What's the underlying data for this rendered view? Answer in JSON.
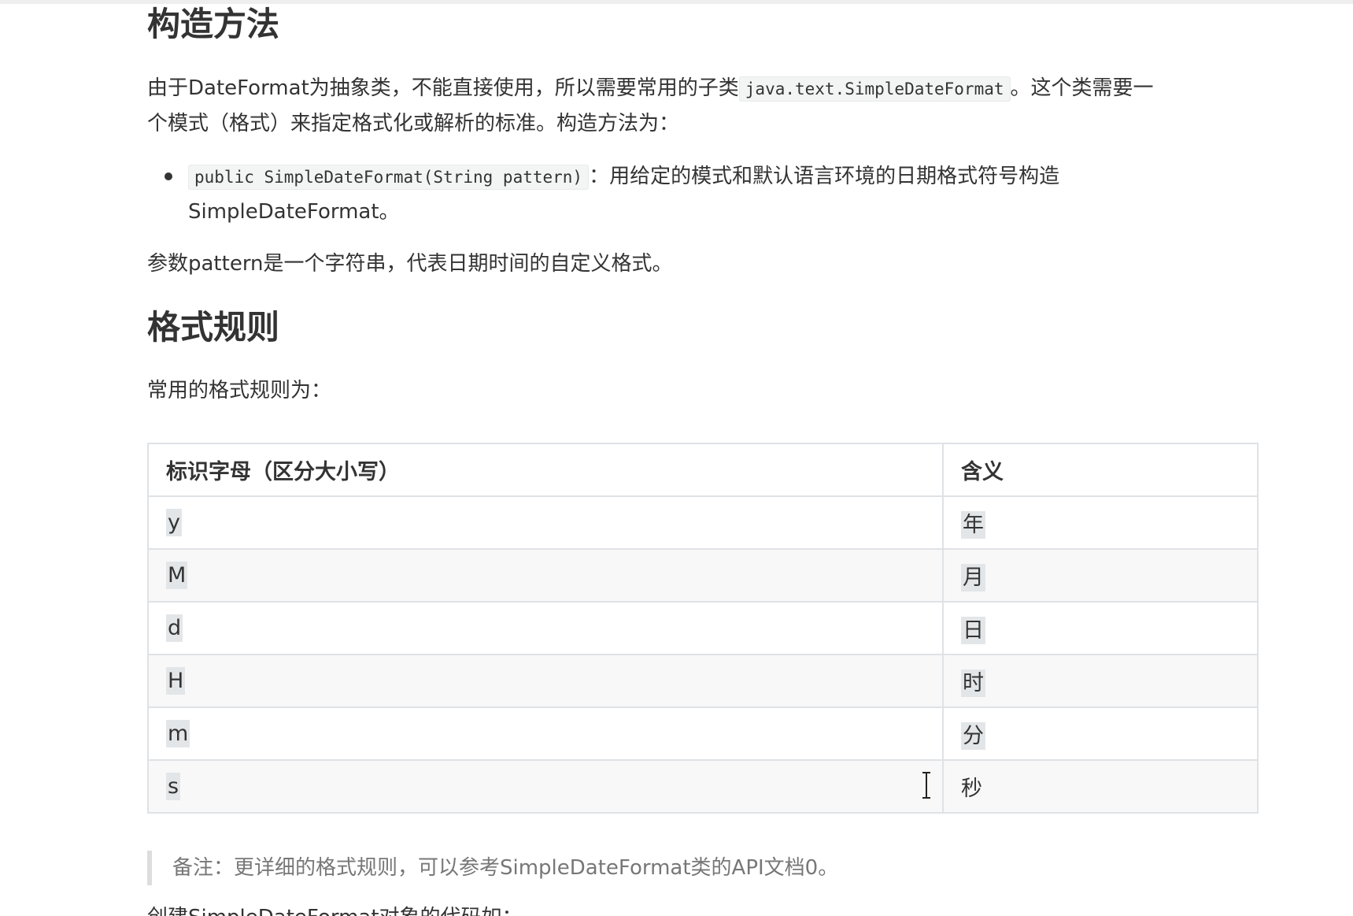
{
  "section1": {
    "heading": "构造方法",
    "p1_a": "由于DateFormat为抽象类，不能直接使用，所以需要常用的子类",
    "p1_code": "java.text.SimpleDateFormat",
    "p1_b": "。这个类需要一",
    "p1_line2": "个模式（格式）来指定格式化或解析的标准。构造方法为：",
    "bullet_code": "public SimpleDateFormat(String pattern)",
    "bullet_text": "：用给定的模式和默认语言环境的日期格式符号构造",
    "bullet_line2": "SimpleDateFormat。",
    "p2": "参数pattern是一个字符串，代表日期时间的自定义格式。"
  },
  "section2": {
    "heading": "格式规则",
    "intro": "常用的格式规则为：",
    "table": {
      "headers": [
        "标识字母（区分大小写）",
        "含义"
      ],
      "rows": [
        [
          "y",
          "年"
        ],
        [
          "M",
          "月"
        ],
        [
          "d",
          "日"
        ],
        [
          "H",
          "时"
        ],
        [
          "m",
          "分"
        ],
        [
          "s",
          "秒"
        ]
      ]
    },
    "note": "备注：更详细的格式规则，可以参考SimpleDateFormat类的API文档0。",
    "cut_line": "创建SimpleDateFormat对象的代码如："
  }
}
